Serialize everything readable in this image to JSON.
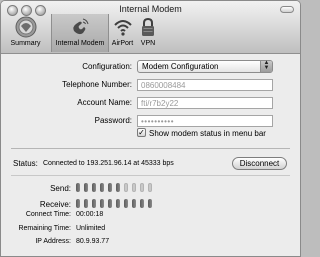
{
  "window": {
    "title": "Internal Modem"
  },
  "toolbar": {
    "items": [
      {
        "label": "Summary",
        "icon": "summary-icon"
      },
      {
        "label": "Internal Modem",
        "icon": "modem-icon",
        "selected": true
      },
      {
        "label": "AirPort",
        "icon": "airport-icon"
      },
      {
        "label": "VPN",
        "icon": "vpn-lock-icon"
      }
    ]
  },
  "form": {
    "configuration_label": "Configuration:",
    "configuration_value": "Modem Configuration",
    "telephone_label": "Telephone Number:",
    "telephone_value": "0860008484",
    "account_label": "Account Name:",
    "account_value": "fti/r7b2y22",
    "password_label": "Password:",
    "password_value": "••••••••••",
    "show_status_label": "Show modem status in menu bar",
    "show_status_checked": true
  },
  "status": {
    "label": "Status:",
    "text": "Connected to 193.251.96.14 at 45333 bps",
    "disconnect_label": "Disconnect"
  },
  "details": {
    "send_label": "Send:",
    "receive_label": "Receive:",
    "send_level": [
      1,
      1,
      1,
      1,
      1,
      1,
      0,
      0,
      0,
      0
    ],
    "receive_level": [
      1,
      1,
      1,
      1,
      1,
      1,
      1,
      1,
      1,
      1
    ],
    "connect_time_label": "Connect Time:",
    "connect_time_value": "00:00:18",
    "remaining_time_label": "Remaining Time:",
    "remaining_time_value": "Unlimited",
    "ip_label": "IP Address:",
    "ip_value": "80.9.93.77"
  }
}
